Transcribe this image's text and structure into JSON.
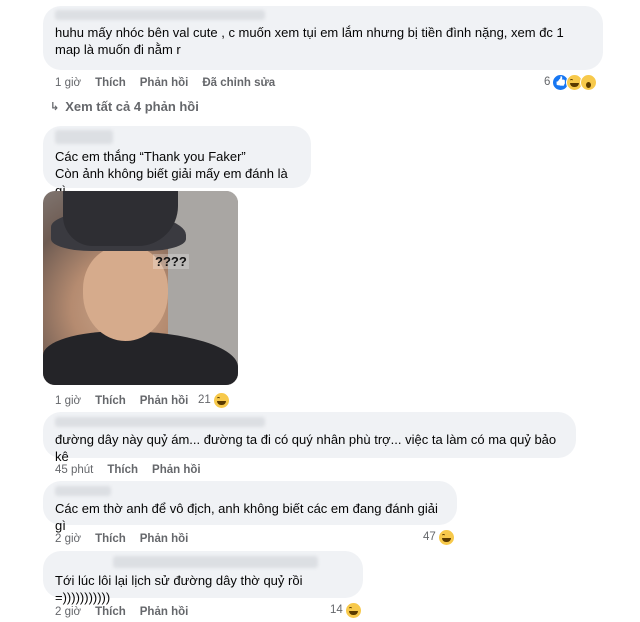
{
  "comments": [
    {
      "text": "huhu mấy nhóc bên val cute  , c muốn xem tụi em lắm nhưng bị tiền đình nặng, xem đc 1 map là muốn đi nằm r",
      "time": "1 giờ",
      "like": "Thích",
      "reply": "Phản hồi",
      "edited": "Đã chỉnh sửa",
      "reaction_count": "6",
      "reactions": [
        "like-icon",
        "haha-icon",
        "wow-icon"
      ]
    },
    {
      "text": "Các em thắng “Thank you Faker”\nCòn ảnh không biết giải mấy em đánh là gì",
      "time": "1 giờ",
      "like": "Thích",
      "reply": "Phản hồi",
      "reaction_count": "21",
      "reactions": [
        "haha-icon"
      ],
      "photo_caption": "????"
    },
    {
      "text": "đường dây này quỷ ám... đường ta đi có quý nhân phù trợ... việc ta làm có ma quỷ bảo kê",
      "time": "45 phút",
      "like": "Thích",
      "reply": "Phản hồi"
    },
    {
      "text": "Các em thờ anh để vô địch, anh không biết các em đang đánh giải gì",
      "time": "2 giờ",
      "like": "Thích",
      "reply": "Phản hồi",
      "reaction_count": "47",
      "reactions": [
        "haha-icon"
      ]
    },
    {
      "text": "Tới lúc lôi lại lịch sử đường dây thờ quỷ rồi =)))))))))))",
      "time": "2 giờ",
      "like": "Thích",
      "reply": "Phản hồi",
      "reaction_count": "14",
      "reactions": [
        "haha-icon"
      ]
    }
  ],
  "see_more": "Xem tất cả 4 phản hồi",
  "colors": {
    "bubble": "#f0f2f5",
    "meta": "#65676b",
    "like_blue": "#1877f2",
    "haha_yellow": "#f7c94b"
  }
}
